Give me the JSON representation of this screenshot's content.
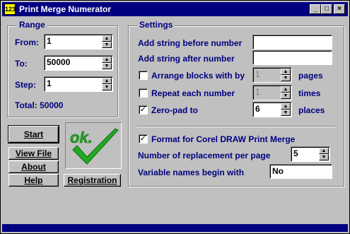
{
  "window": {
    "title": "Print Merge Numerator",
    "icon": "app-icon-123"
  },
  "range": {
    "title": "Range",
    "from_label": "From:",
    "from_value": "1",
    "to_label": "To:",
    "to_value": "50000",
    "step_label": "Step:",
    "step_value": "1",
    "total": "Total: 50000"
  },
  "settings": {
    "title": "Settings",
    "before_label": "Add string before number",
    "before_value": "",
    "after_label": "Add string after number",
    "after_value": "",
    "arrange_label": "Arrange blocks with by",
    "arrange_value": "1",
    "arrange_unit": "pages",
    "arrange_checked": false,
    "repeat_label": "Repeat each number",
    "repeat_value": "1",
    "repeat_unit": "times",
    "repeat_checked": false,
    "zeropad_label": "Zero-pad to",
    "zeropad_value": "6",
    "zeropad_unit": "places",
    "zeropad_checked": true,
    "corel_label": "Format for Corel DRAW Print Merge",
    "corel_checked": true,
    "replace_label": "Number of replacement per page",
    "replace_value": "5",
    "varnames_label": "Variable names begin with",
    "varnames_value": "No"
  },
  "buttons": {
    "start": "Start",
    "view_file": "View File",
    "about": "About",
    "help": "Help",
    "registration": "Registration"
  },
  "status": {
    "ok_text": "ok."
  },
  "colors": {
    "label": "#000080",
    "titlebar": "#000080",
    "ok_green": "#22aa22"
  }
}
